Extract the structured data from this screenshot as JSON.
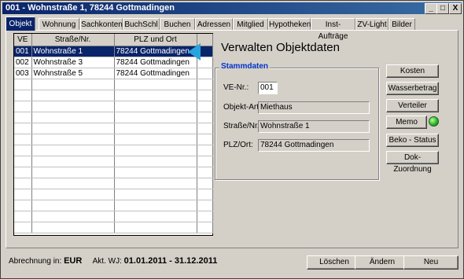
{
  "window": {
    "title": "001 - Wohnstraße 1, 78244 Gottmadingen"
  },
  "titlebar_buttons": {
    "minimize": "_",
    "maximize": "□",
    "close": "X"
  },
  "tabs": [
    {
      "label": "Objekt",
      "active": true
    },
    {
      "label": "Wohnung"
    },
    {
      "label": "Sachkonten"
    },
    {
      "label": "BuchSchl"
    },
    {
      "label": "Buchen"
    },
    {
      "label": "Adressen"
    },
    {
      "label": "Mitglied"
    },
    {
      "label": "Hypotheken"
    },
    {
      "label": "Inst-Aufträge"
    },
    {
      "label": "ZV-Light"
    },
    {
      "label": "Bilder"
    }
  ],
  "grid": {
    "columns": [
      "VE",
      "Straße/Nr.",
      "PLZ und Ort"
    ],
    "rows": [
      {
        "ve": "001",
        "strasse": "Wohnstraße 1",
        "ort": "78244 Gottmadingen",
        "selected": true
      },
      {
        "ve": "002",
        "strasse": "Wohnstraße 3",
        "ort": "78244 Gottmadingen"
      },
      {
        "ve": "003",
        "strasse": "Wohnstraße 5",
        "ort": "78244 Gottmadingen"
      }
    ],
    "empty_row_count": 14,
    "arrow_color": "#29a3df"
  },
  "heading": "Verwalten Objektdaten",
  "stammdaten": {
    "legend": "Stammdaten",
    "ve_label": "VE-Nr.:",
    "ve_value": "001",
    "objektart_label": "Objekt-Art:",
    "objektart_value": "Miethaus",
    "strasse_label": "Straße/Nr.:",
    "strasse_value": "Wohnstraße 1",
    "plz_label": "PLZ/Ort:",
    "plz_value": "78244 Gottmadingen"
  },
  "side_buttons": {
    "kosten": "Kosten",
    "wasserbetrag": "Wasserbetrag",
    "verteiler": "Verteiler",
    "memo": "Memo",
    "beko_status": "Beko - Status",
    "dok_zuordnung": "Dok-Zuordnung"
  },
  "memo_indicator_color": "#20b020",
  "status": {
    "abrechnung_label": "Abrechnung in:",
    "currency": "EUR",
    "wj_label": "Akt. WJ:",
    "wj_value": "01.01.2011 - 31.12.2011"
  },
  "bottom_buttons": {
    "loeschen": "Löschen",
    "aendern": "Ändern",
    "neu": "Neu"
  }
}
